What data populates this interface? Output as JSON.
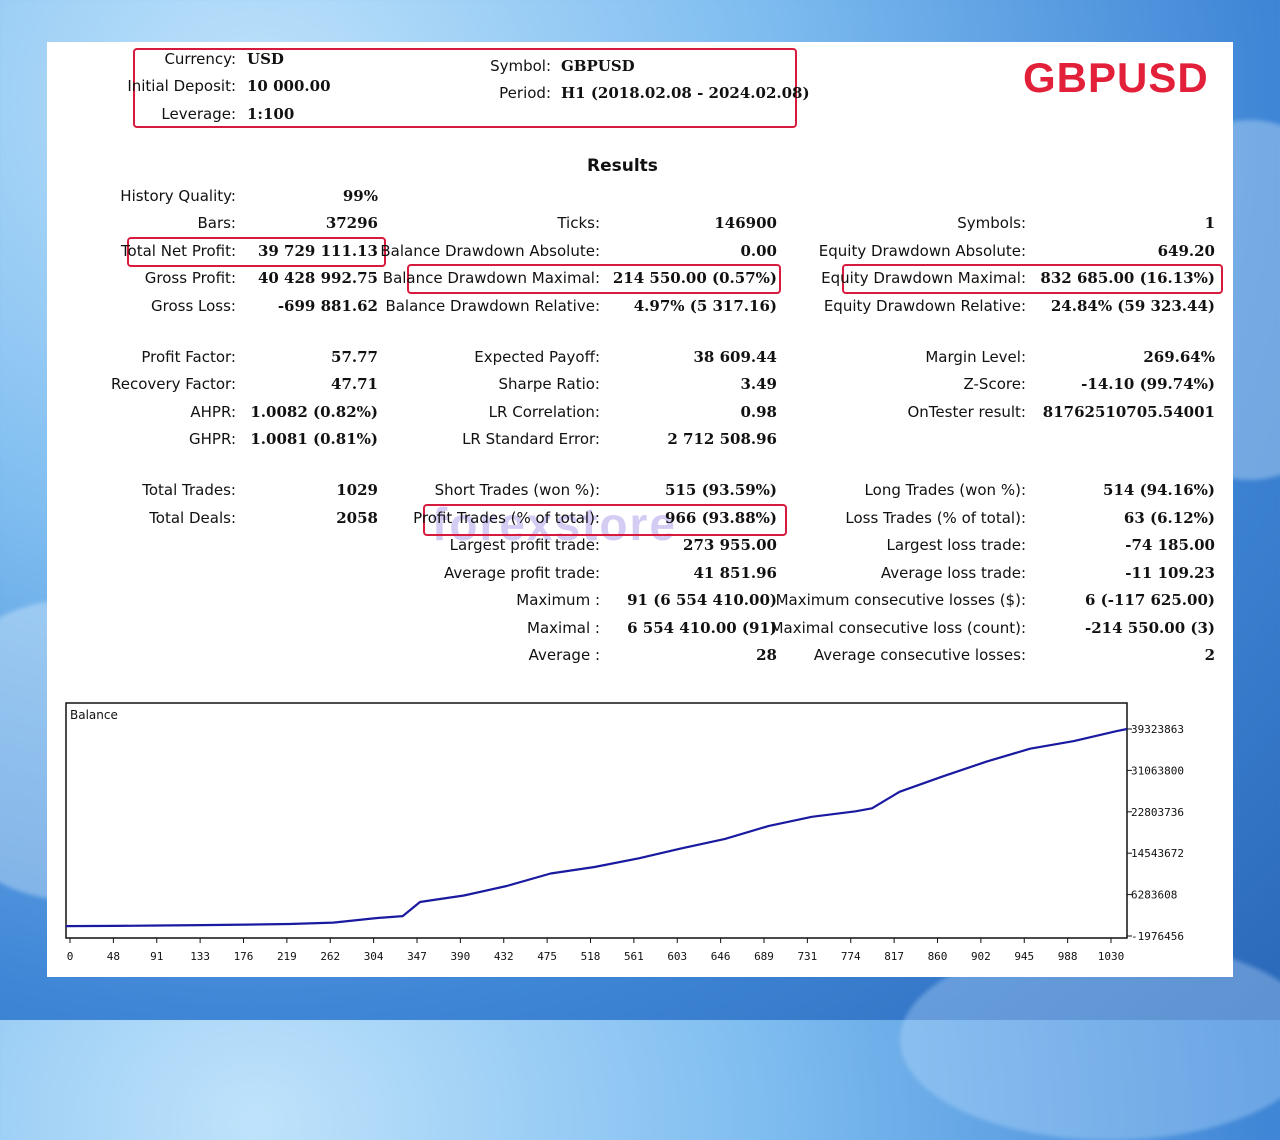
{
  "header": {
    "currency_label": "Currency:",
    "currency_value": "USD",
    "deposit_label": "Initial Deposit:",
    "deposit_value": "10 000.00",
    "leverage_label": "Leverage:",
    "leverage_value": "1:100",
    "symbol_label": "Symbol:",
    "symbol_value": "GBPUSD",
    "period_label": "Period:",
    "period_value": "H1 (2018.02.08 - 2024.02.08)"
  },
  "big_symbol": "GBPUSD",
  "results_title": "Results",
  "watermark": "forexstore",
  "colors": {
    "accent_red": "#d81b3c",
    "title_red": "#e2203a",
    "balance_line": "#1a1aa0"
  },
  "col1": [
    {
      "label": "History Quality:",
      "value": "99%"
    },
    {
      "label": "Bars:",
      "value": "37296"
    },
    {
      "label": "Total Net Profit:",
      "value": "39 729 111.13"
    },
    {
      "label": "Gross Profit:",
      "value": "40 428 992.75"
    },
    {
      "label": "Gross Loss:",
      "value": "-699 881.62"
    },
    {
      "label": "Profit Factor:",
      "value": "57.77"
    },
    {
      "label": "Recovery Factor:",
      "value": "47.71"
    },
    {
      "label": "AHPR:",
      "value": "1.0082 (0.82%)"
    },
    {
      "label": "GHPR:",
      "value": "1.0081 (0.81%)"
    },
    {
      "label": "Total Trades:",
      "value": "1029"
    },
    {
      "label": "Total Deals:",
      "value": "2058"
    }
  ],
  "col2": [
    {
      "label": "Ticks:",
      "value": "146900"
    },
    {
      "label": "Balance Drawdown Absolute:",
      "value": "0.00"
    },
    {
      "label": "Balance Drawdown Maximal:",
      "value": "214 550.00 (0.57%)"
    },
    {
      "label": "Balance Drawdown Relative:",
      "value": "4.97% (5 317.16)"
    },
    {
      "label": "Expected Payoff:",
      "value": "38 609.44"
    },
    {
      "label": "Sharpe Ratio:",
      "value": "3.49"
    },
    {
      "label": "LR Correlation:",
      "value": "0.98"
    },
    {
      "label": "LR Standard Error:",
      "value": "2 712 508.96"
    },
    {
      "label": "Short Trades (won %):",
      "value": "515 (93.59%)"
    },
    {
      "label": "Profit Trades (% of total):",
      "value": "966 (93.88%)"
    },
    {
      "label": "Largest profit trade:",
      "value": "273 955.00"
    },
    {
      "label": "Average profit trade:",
      "value": "41 851.96"
    },
    {
      "label": "Maximum :",
      "value": "91 (6 554 410.00)"
    },
    {
      "label": "Maximal :",
      "value": "6 554 410.00 (91)"
    },
    {
      "label": "Average :",
      "value": "28"
    }
  ],
  "col3": [
    {
      "label": "Symbols:",
      "value": "1"
    },
    {
      "label": "Equity Drawdown Absolute:",
      "value": "649.20"
    },
    {
      "label": "Equity Drawdown Maximal:",
      "value": "832 685.00 (16.13%)"
    },
    {
      "label": "Equity Drawdown Relative:",
      "value": "24.84% (59 323.44)"
    },
    {
      "label": "Margin Level:",
      "value": "269.64%"
    },
    {
      "label": "Z-Score:",
      "value": "-14.10 (99.74%)"
    },
    {
      "label": "OnTester result:",
      "value": "81762510705.54001"
    },
    {
      "label": "Long Trades (won %):",
      "value": "514 (94.16%)"
    },
    {
      "label": "Loss Trades (% of total):",
      "value": "63 (6.12%)"
    },
    {
      "label": "Largest loss trade:",
      "value": "-74 185.00"
    },
    {
      "label": "Average loss trade:",
      "value": "-11 109.23"
    },
    {
      "label": "Maximum consecutive losses ($):",
      "value": "6 (-117 625.00)"
    },
    {
      "label": "Maximal consecutive loss (count):",
      "value": "-214 550.00 (3)"
    },
    {
      "label": "Average consecutive losses:",
      "value": "2"
    }
  ],
  "chart_data": {
    "type": "line",
    "title": "Balance",
    "xlabel": "",
    "ylabel": "",
    "x_ticks": [
      "0",
      "48",
      "91",
      "133",
      "176",
      "219",
      "262",
      "304",
      "347",
      "390",
      "432",
      "475",
      "518",
      "561",
      "603",
      "646",
      "689",
      "731",
      "774",
      "817",
      "860",
      "902",
      "945",
      "988",
      "1030"
    ],
    "y_ticks": [
      "39323863",
      "31063800",
      "22803736",
      "14543672",
      "6283608",
      "-1976456"
    ],
    "xlim": [
      0,
      1040
    ],
    "ylim": [
      -1976456,
      39323863
    ],
    "series": [
      {
        "x": [
          0,
          48,
          91,
          133,
          176,
          219,
          262,
          304,
          330,
          347,
          360,
          390,
          432,
          475,
          518,
          561,
          603,
          646,
          689,
          731,
          774,
          790,
          817,
          860,
          902,
          945,
          988,
          1030,
          1040
        ],
        "y": [
          0,
          30000,
          120000,
          200000,
          300000,
          420000,
          700000,
          1600000,
          2000000,
          4800000,
          5200000,
          6100000,
          8000000,
          10500000,
          11800000,
          13500000,
          15500000,
          17400000,
          20000000,
          21800000,
          22900000,
          23500000,
          26800000,
          29900000,
          32800000,
          35400000,
          36900000,
          38900000,
          39323863
        ]
      }
    ]
  }
}
